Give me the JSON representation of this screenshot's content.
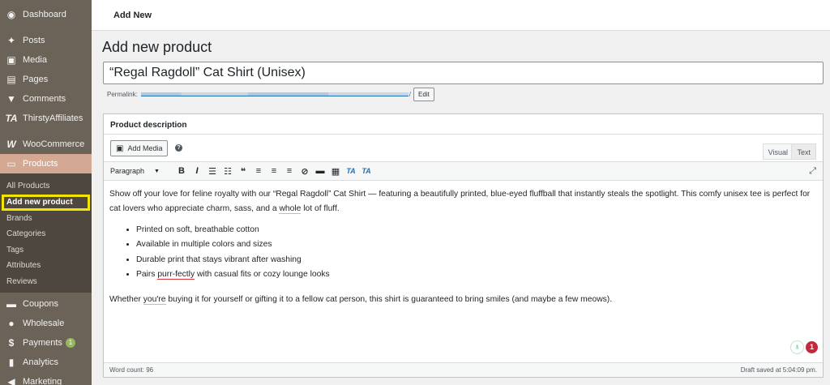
{
  "sidebar": {
    "items": [
      {
        "label": "Dashboard",
        "icon": "dashboard-icon"
      },
      {
        "label": "Posts",
        "icon": "pin-icon"
      },
      {
        "label": "Media",
        "icon": "media-icon"
      },
      {
        "label": "Pages",
        "icon": "pages-icon"
      },
      {
        "label": "Comments",
        "icon": "comment-icon"
      },
      {
        "label": "ThirstyAffiliates",
        "icon": "ta-icon"
      },
      {
        "label": "WooCommerce",
        "icon": "woo-icon"
      },
      {
        "label": "Products",
        "icon": "products-icon"
      }
    ],
    "submenu": [
      "All Products",
      "Add new product",
      "Brands",
      "Categories",
      "Tags",
      "Attributes",
      "Reviews"
    ],
    "bottom_items": [
      {
        "label": "Coupons",
        "icon": "coupon-icon"
      },
      {
        "label": "Wholesale",
        "icon": "wholesale-icon"
      },
      {
        "label": "Payments",
        "icon": "payments-icon",
        "badge": "1"
      },
      {
        "label": "Analytics",
        "icon": "analytics-icon"
      },
      {
        "label": "Marketing",
        "icon": "megaphone-icon"
      }
    ]
  },
  "topbar": {
    "crumb": "Add New"
  },
  "page": {
    "title": "Add new product",
    "product_title": "“Regal Ragdoll” Cat Shirt (Unisex)",
    "permalink_label": "Permalink:",
    "permalink_slash": "/",
    "edit_label": "Edit"
  },
  "editor": {
    "box_title": "Product description",
    "add_media": "Add Media",
    "tab_visual": "Visual",
    "tab_text": "Text",
    "format": "Paragraph",
    "intro_a": "Show off your love for feline royalty with our “Regal Ragdoll” Cat Shirt — featuring a beautifully printed, blue-eyed fluffball that instantly steals the spotlight. This comfy unisex tee is perfect for cat lovers who appreciate charm, sass, and a ",
    "intro_u": "whole",
    "intro_b": " lot of fluff.",
    "bullets": {
      "b1": "Printed on soft, breathable cotton",
      "b2": "Available in multiple colors and sizes",
      "b3": "Durable print that stays vibrant after washing",
      "b4_a": "Pairs ",
      "b4_u": "purr-fectly",
      "b4_b": " with casual fits or cozy lounge looks"
    },
    "closing_a": "Whether ",
    "closing_u": "you're",
    "closing_b": " buying it for yourself or gifting it to a fellow cat person, this shirt is guaranteed to bring smiles (and maybe a few meows).",
    "grammar_count": "1",
    "word_count": "Word count: 96",
    "draft_status": "Draft saved at 5:04:09 pm."
  },
  "colors": {
    "sidebar": "#6b6357",
    "active": "#d4a993",
    "highlight": "#f5e300"
  }
}
